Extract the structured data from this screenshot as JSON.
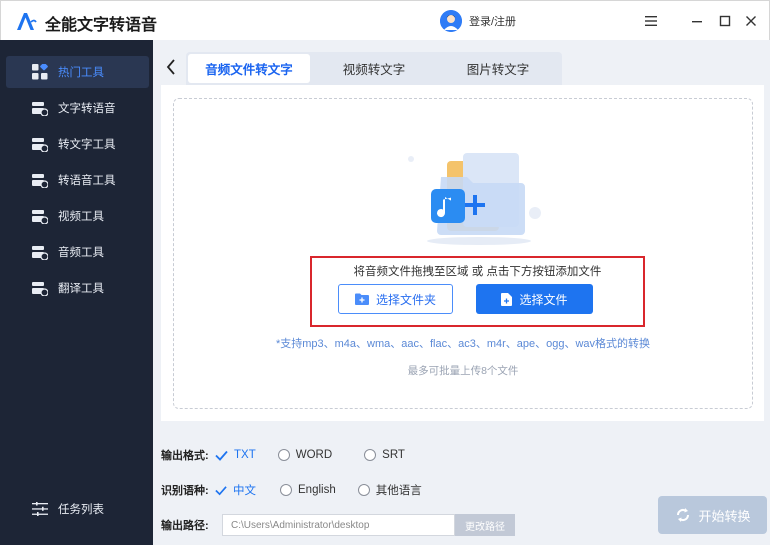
{
  "app": {
    "title": "全能文字转语音",
    "login_label": "登录/注册"
  },
  "sidebar": {
    "items": [
      {
        "label": "热门工具",
        "icon": "grid-icon",
        "active": true
      },
      {
        "label": "文字转语音",
        "icon": "toolbox-icon",
        "active": false
      },
      {
        "label": "转文字工具",
        "icon": "toolbox-icon",
        "active": false
      },
      {
        "label": "转语音工具",
        "icon": "toolbox-icon",
        "active": false
      },
      {
        "label": "视频工具",
        "icon": "toolbox-icon",
        "active": false
      },
      {
        "label": "音频工具",
        "icon": "toolbox-icon",
        "active": false
      },
      {
        "label": "翻译工具",
        "icon": "toolbox-icon",
        "active": false
      }
    ],
    "task_list_label": "任务列表"
  },
  "tabs": [
    {
      "label": "音频文件转文字",
      "active": true
    },
    {
      "label": "视频转文字",
      "active": false
    },
    {
      "label": "图片转文字",
      "active": false
    }
  ],
  "dropzone": {
    "hint": "将音频文件拖拽至区域 或 点击下方按钮添加文件",
    "select_folder_label": "选择文件夹",
    "select_file_label": "选择文件",
    "formats_text": "*支持mp3、m4a、wma、aac、flac、ac3、m4r、ape、ogg、wav格式的转换",
    "limit_text": "最多可批量上传8个文件"
  },
  "options": {
    "output_format_label": "输出格式:",
    "formats": [
      {
        "label": "TXT",
        "checked": true
      },
      {
        "label": "WORD",
        "checked": false
      },
      {
        "label": "SRT",
        "checked": false
      }
    ],
    "language_label": "识别语种:",
    "languages": [
      {
        "label": "中文",
        "checked": true
      },
      {
        "label": "English",
        "checked": false
      },
      {
        "label": "其他语言",
        "checked": false
      }
    ],
    "path_label": "输出路径:",
    "path_value": "C:\\Users\\Administrator\\desktop",
    "change_path_label": "更改路径"
  },
  "start_label": "开始转换",
  "colors": {
    "accent": "#1e74f0",
    "sidebar_bg": "#1d2536",
    "highlight_border": "#d9262c"
  }
}
